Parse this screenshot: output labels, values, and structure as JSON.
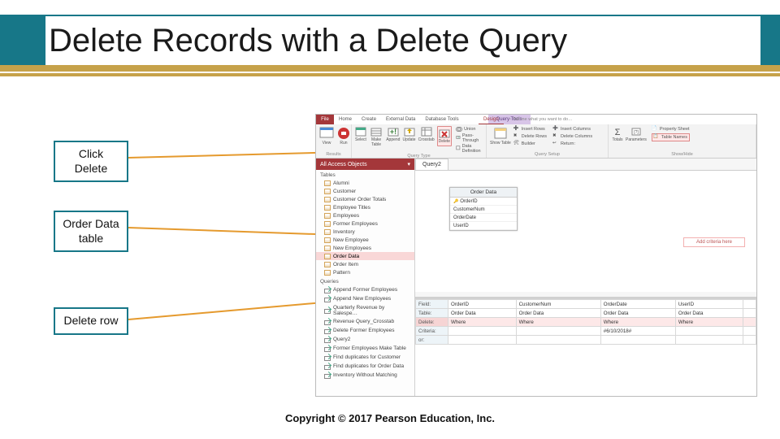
{
  "title": "Delete Records with a Delete Query",
  "callouts": {
    "c1": "Click Delete",
    "c2": "Order Data table",
    "c3": "Delete row"
  },
  "tabs": {
    "file": "File",
    "home": "Home",
    "create": "Create",
    "external": "External Data",
    "dbtools": "Database Tools",
    "context": "Query Tools",
    "design": "Design",
    "tell": "Tell me what you want to do…"
  },
  "ribbon": {
    "results": {
      "view": "View",
      "run": "Run",
      "label": "Results"
    },
    "querytype": {
      "select": "Select",
      "make": "Make Table",
      "append": "Append",
      "update": "Update",
      "crosstab": "Crosstab",
      "delete": "Delete",
      "union": "Union",
      "passthrough": "Pass-Through",
      "datadef": "Data Definition",
      "label": "Query Type"
    },
    "setup": {
      "show": "Show Table",
      "insertrows": "Insert Rows",
      "deleterows": "Delete Rows",
      "builder": "Builder",
      "insertcols": "Insert Columns",
      "deletecols": "Delete Columns",
      "return": "Return:",
      "label": "Query Setup"
    },
    "showhide": {
      "totals": "Totals",
      "params": "Parameters",
      "propsheet": "Property Sheet",
      "tablenames": "Table Names",
      "label": "Show/Hide"
    }
  },
  "nav": {
    "header": "All Access Objects",
    "tables_label": "Tables",
    "tables": [
      "Alumni",
      "Customer",
      "Customer Order Totals",
      "Employee Titles",
      "Employees",
      "Former Employees",
      "Inventory",
      "New Employee",
      "New Employees",
      "Order Data",
      "Order Item",
      "Pattern"
    ],
    "queries_label": "Queries",
    "queries": [
      "Append Former Employees",
      "Append New Employees",
      "Quarterly Revenue by Salespe…",
      "Revenue Query_Crosstab",
      "Delete Former Employees",
      "Query2",
      "Former Employees Make Table",
      "Find duplicates for Customer",
      "Find duplicates for Order Data",
      "Inventory Without Matching"
    ]
  },
  "doc_tab": "Query2",
  "tablebox": {
    "title": "Order Data",
    "fields": [
      "OrderID",
      "CustomerNum",
      "OrderDate",
      "UserID"
    ]
  },
  "criteria_hint": "Add criteria here",
  "grid": {
    "labels": {
      "field": "Field:",
      "table": "Table:",
      "delete": "Delete:",
      "criteria": "Criteria:",
      "or": "or:"
    },
    "cols": [
      {
        "field": "OrderID",
        "table": "Order Data",
        "delete": "Where",
        "criteria": ""
      },
      {
        "field": "CustomerNum",
        "table": "Order Data",
        "delete": "Where",
        "criteria": ""
      },
      {
        "field": "OrderDate",
        "table": "Order Data",
        "delete": "Where",
        "criteria": "#6/10/2018#"
      },
      {
        "field": "UserID",
        "table": "Order Data",
        "delete": "Where",
        "criteria": ""
      }
    ]
  },
  "copyright": "Copyright © 2017 Pearson Education, Inc."
}
